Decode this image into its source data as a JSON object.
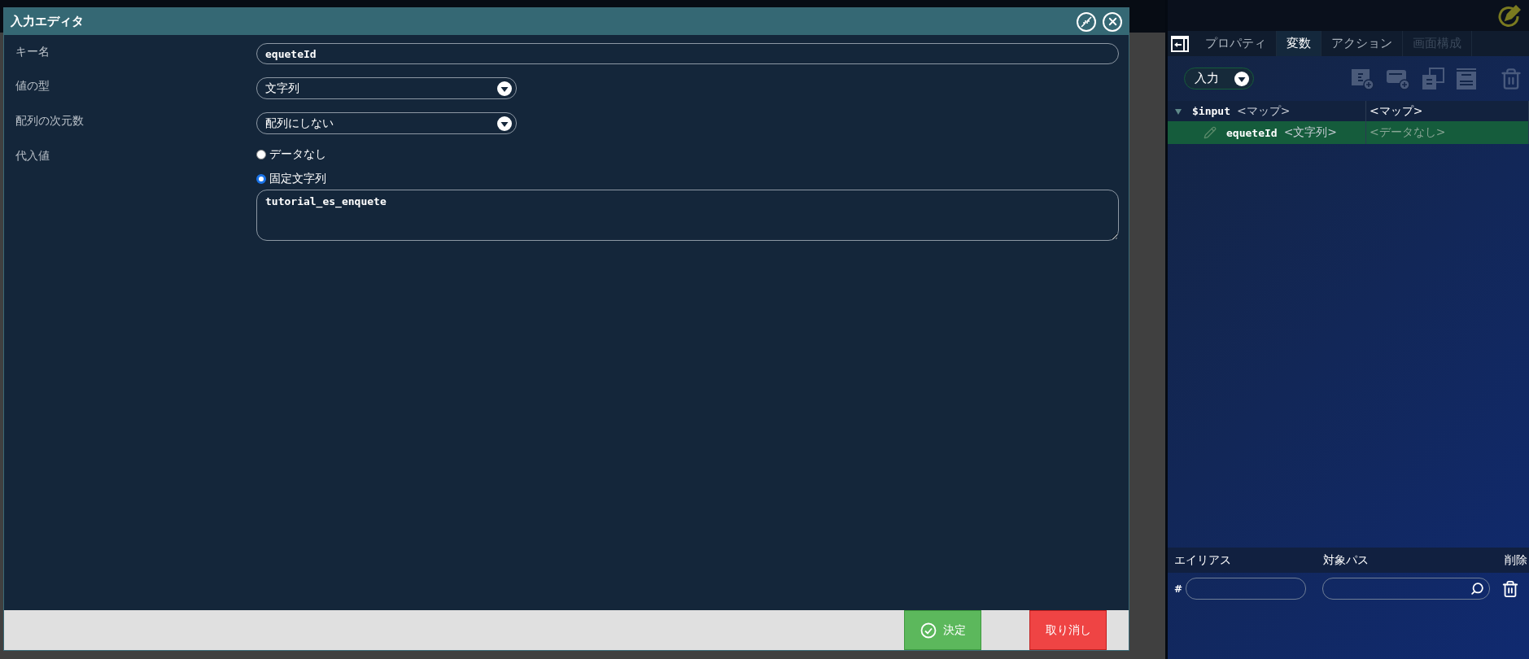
{
  "dialog": {
    "title": "入力エディタ",
    "key_name": {
      "label": "キー名",
      "value": "equeteId"
    },
    "value_type": {
      "label": "値の型",
      "value": "文字列"
    },
    "array_dims": {
      "label": "配列の次元数",
      "value": "配列にしない"
    },
    "assigned_value": {
      "label": "代入値",
      "options": [
        {
          "label": "データなし",
          "selected": false
        },
        {
          "label": "固定文字列",
          "selected": true
        }
      ],
      "text": "tutorial_es_enquete"
    },
    "buttons": {
      "confirm": "決定",
      "cancel": "取り消し"
    }
  },
  "panel": {
    "tabs": [
      {
        "label": "プロパティ",
        "selected": false,
        "disabled": false
      },
      {
        "label": "変数",
        "selected": true,
        "disabled": false
      },
      {
        "label": "アクション",
        "selected": false,
        "disabled": false
      },
      {
        "label": "画面構成",
        "selected": false,
        "disabled": true
      }
    ],
    "scope": "入力",
    "tree": [
      {
        "name": "$input",
        "type": "<マップ>",
        "value": "<マップ>",
        "expanded": true,
        "selected": false,
        "children": [
          {
            "name": "equeteId",
            "type": "<文字列>",
            "value": "<データなし>",
            "selected": true
          }
        ]
      }
    ],
    "alias_table": {
      "columns": [
        "エイリアス",
        "対象パス",
        "削除"
      ],
      "row_mark": "#"
    }
  }
}
